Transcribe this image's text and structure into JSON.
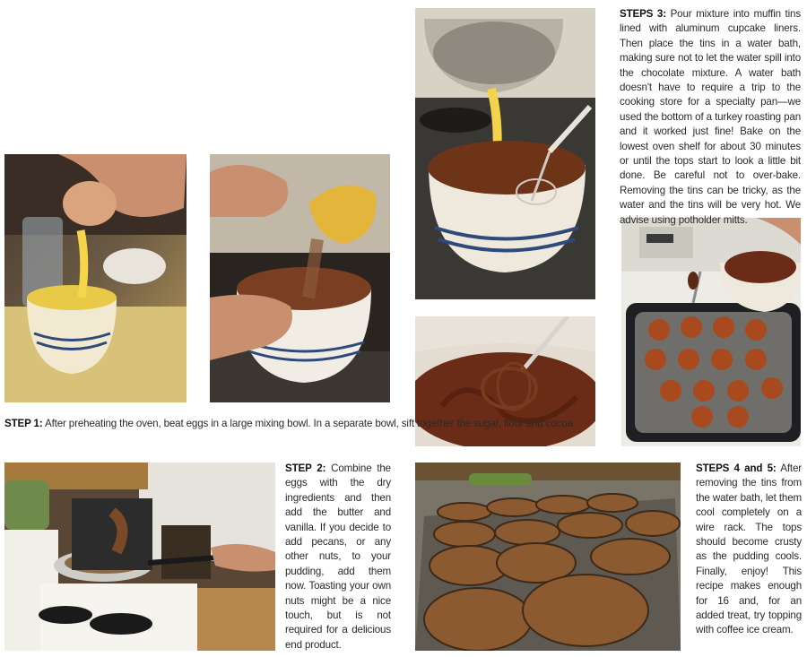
{
  "steps": [
    {
      "label": "STEP 1:",
      "text": "After preheating the oven, beat eggs in a large mixing bowl. In a separate bowl, sift together the sugar, flour and cocoa."
    },
    {
      "label": "STEP 2:",
      "text": "Combine the eggs with the dry ingredients and then add the butter and vanilla. If you decide to add pecans, or any other nuts, to your pudding, add them now. Toasting your own nuts might be a nice touch, but is not required for a delicious end product."
    },
    {
      "label": "STEPS 3:",
      "text": "Pour mixture into muffin tins lined with aluminum cupcake liners. Then place the tins in a water bath, making sure not to let the water spill into the chocolate mixture. A water bath doesn't have to require a trip to the cooking store for a specialty pan—we used the bottom of a turkey roasting pan and it worked just fine! Bake on the lowest oven shelf for about 30 minutes or until the tops start to look a little bit done. Be careful not to over-bake. Removing the tins can be tricky, as the water and the tins will be very hot. We advise using potholder mitts."
    },
    {
      "label": "STEPS 4 and 5:",
      "text": "After removing the tins from the water bath, let them cool completely on a wire rack. The tops should become crusty as the pudding cools. Finally, enjoy! This recipe makes enough for 16 and, for an added treat, try topping with coffee ice cream."
    }
  ]
}
